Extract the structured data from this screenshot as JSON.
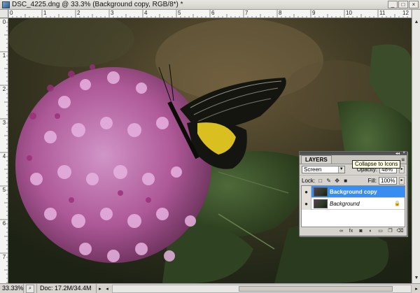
{
  "window": {
    "title": "DSC_4225.dng @ 33.3% (Background copy, RGB/8*) *",
    "buttons": {
      "minimize": "_",
      "maximize": "□",
      "close": "×"
    }
  },
  "rulers": {
    "top_labels": [
      "0",
      "1",
      "2",
      "3",
      "4",
      "5",
      "6",
      "7",
      "8",
      "9",
      "10",
      "11",
      "12"
    ],
    "left_labels": [
      "0",
      "1",
      "2",
      "3",
      "4",
      "5",
      "6",
      "7"
    ]
  },
  "status": {
    "zoom": "33.33%",
    "doc": "Doc: 17.2M/34.4M"
  },
  "layers_panel": {
    "tab": "LAYERS",
    "blend_mode": "Screen",
    "opacity_label": "Opacity:",
    "opacity_value": "48%",
    "lock_label": "Lock:",
    "fill_label": "Fill:",
    "fill_value": "100%",
    "layers": [
      {
        "name": "Background copy",
        "selected": true,
        "locked": false
      },
      {
        "name": "Background",
        "selected": false,
        "locked": true
      }
    ],
    "bottom_icons": [
      "link-icon",
      "fx-icon",
      "mask-icon",
      "adjustment-icon",
      "folder-icon",
      "new-layer-icon",
      "trash-icon"
    ]
  },
  "tooltip": {
    "text": "Collapse to Icons"
  },
  "icons": {
    "eye": "●",
    "lock": "🔒",
    "dropdown": "▼",
    "menu": "≡",
    "collapse": "◂◂",
    "close": "×",
    "scroll_up": "▲",
    "scroll_down": "▼",
    "scroll_left": "◂",
    "scroll_right": "▸"
  },
  "colors": {
    "selection": "#3a8df0",
    "tooltip_bg": "#ffffe1",
    "flower": "#c45aa6"
  }
}
